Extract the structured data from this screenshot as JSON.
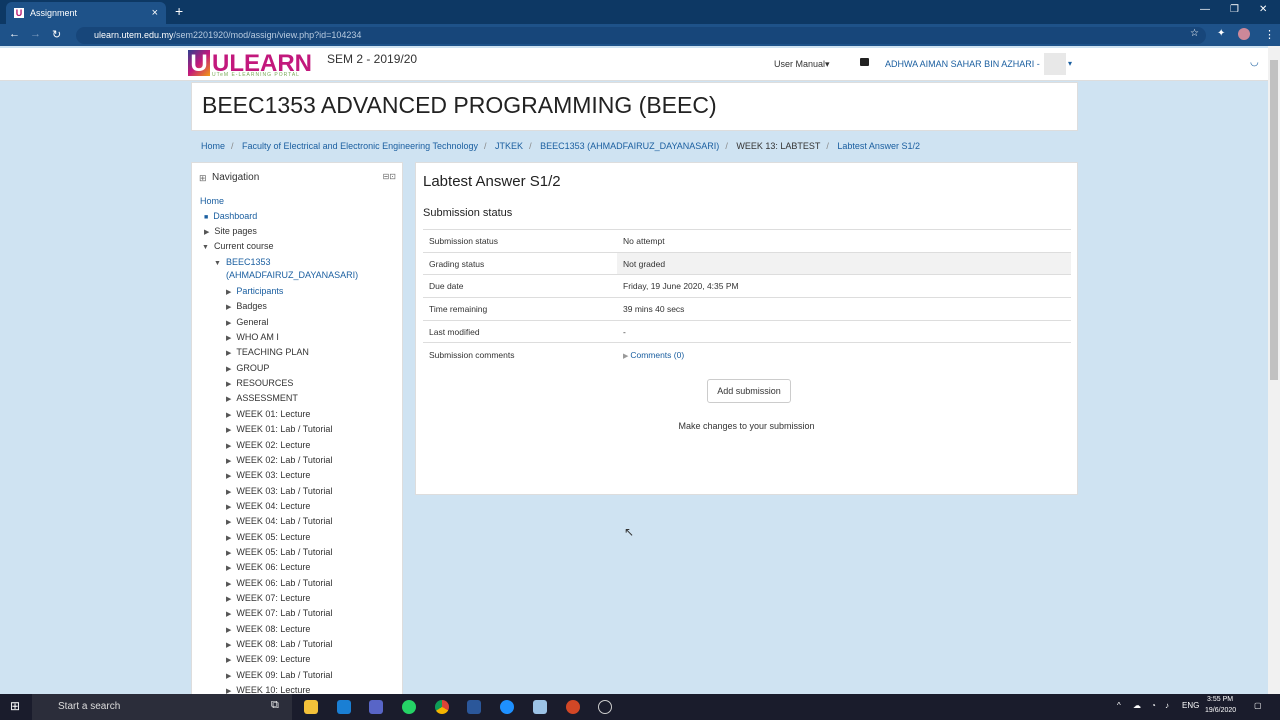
{
  "browser": {
    "tab_title": "Assignment",
    "url_host": "ulearn.utem.edu.my",
    "url_path": "/sem2201920/mod/assign/view.php?id=104234"
  },
  "site": {
    "logo_text": "ULEARN",
    "logo_sub": "UTeM E-LEARNING PORTAL",
    "semester": "SEM 2 - 2019/20",
    "user_manual": "User Manual",
    "user_name": "ADHWA AIMAN SAHAR BIN AZHARI -"
  },
  "course_title": "BEEC1353 ADVANCED PROGRAMMING (BEEC)",
  "breadcrumb": [
    "Home",
    "Faculty of Electrical and Electronic Engineering Technology",
    "JTKEK",
    "BEEC1353 (AHMADFAIRUZ_DAYANASARI)",
    "WEEK 13: LABTEST",
    "Labtest Answer S1/2"
  ],
  "navigation": {
    "title": "Navigation",
    "home": "Home",
    "dashboard": "Dashboard",
    "site_pages": "Site pages",
    "current_course": "Current course",
    "course_line1": "BEEC1353",
    "course_line2": "(AHMADFAIRUZ_DAYANASARI)",
    "items": [
      "Participants",
      "Badges",
      "General",
      "WHO AM I",
      "TEACHING PLAN",
      "GROUP",
      "RESOURCES",
      "ASSESSMENT",
      "WEEK 01: Lecture",
      "WEEK 01: Lab / Tutorial",
      "WEEK 02: Lecture",
      "WEEK 02: Lab / Tutorial",
      "WEEK 03: Lecture",
      "WEEK 03: Lab / Tutorial",
      "WEEK 04: Lecture",
      "WEEK 04: Lab / Tutorial",
      "WEEK 05: Lecture",
      "WEEK 05: Lab / Tutorial",
      "WEEK 06: Lecture",
      "WEEK 06: Lab / Tutorial",
      "WEEK 07: Lecture",
      "WEEK 07: Lab / Tutorial",
      "WEEK 08: Lecture",
      "WEEK 08: Lab / Tutorial",
      "WEEK 09: Lecture",
      "WEEK 09: Lab / Tutorial",
      "WEEK 10: Lecture"
    ]
  },
  "assignment": {
    "title": "Labtest Answer S1/2",
    "section": "Submission status",
    "rows": [
      {
        "label": "Submission status",
        "value": "No attempt"
      },
      {
        "label": "Grading status",
        "value": "Not graded"
      },
      {
        "label": "Due date",
        "value": "Friday, 19 June 2020, 4:35 PM"
      },
      {
        "label": "Time remaining",
        "value": "39 mins 40 secs"
      },
      {
        "label": "Last modified",
        "value": "-"
      },
      {
        "label": "Submission comments",
        "value": "Comments (0)"
      }
    ],
    "add_button": "Add submission",
    "hint": "Make changes to your submission"
  },
  "taskbar": {
    "search": "Start a search",
    "lang": "ENG",
    "time": "3:55 PM",
    "date": "19/6/2020"
  }
}
